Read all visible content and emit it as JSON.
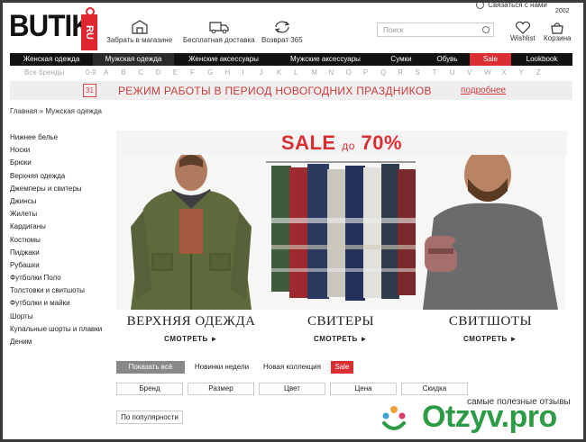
{
  "logo": {
    "word": "BUTIK",
    "badge": "RU"
  },
  "header": {
    "contact": "Связаться с нами",
    "year": "2002",
    "features": [
      "Забрать в магазине",
      "Бесплатная доставка",
      "Возврат 365"
    ],
    "search_placeholder": "Поиск",
    "wishlist": "Wishlist",
    "cart": "Корзина"
  },
  "nav": [
    "Женская одежда",
    "Мужская одежда",
    "Женские аксессуары",
    "Мужские аксессуары",
    "Сумки",
    "Обувь",
    "Sale",
    "Lookbook"
  ],
  "alphabet": [
    "Все бренды",
    "0-9",
    "A",
    "B",
    "C",
    "D",
    "E",
    "F",
    "G",
    "H",
    "I",
    "J",
    "K",
    "L",
    "M",
    "N",
    "O",
    "P",
    "Q",
    "R",
    "S",
    "T",
    "U",
    "V",
    "W",
    "X",
    "Y",
    "Z"
  ],
  "banner": {
    "day": "31",
    "text": "РЕЖИМ РАБОТЫ В ПЕРИОД НОВОГОДНИХ ПРАЗДНИКОВ",
    "link": "подробнее"
  },
  "breadcrumb": "Главная » Мужская одежда",
  "sidebar": [
    "Нижнее белье",
    "Носки",
    "Брюки",
    "Верхняя одежда",
    "Джемперы и свитеры",
    "Джинсы",
    "Жилеты",
    "Кардиганы",
    "Костюмы",
    "Пиджаки",
    "Рубашки",
    "Футболки Поло",
    "Толстовки и свитшоты",
    "Футболки и майки",
    "Шорты",
    "Купальные шорты и плавки",
    "Деним"
  ],
  "promo": {
    "sale": "SALE",
    "sale_small": "до",
    "sale_pct": "70%",
    "panels": [
      {
        "caption": "ВЕРХНЯЯ ОДЕЖДА",
        "more": "СМОТРЕТЬ ►"
      },
      {
        "caption": "СВИТЕРЫ",
        "more": "СМОТРЕТЬ ►"
      },
      {
        "caption": "СВИТШОТЫ",
        "more": "СМОТРЕТЬ ►"
      }
    ]
  },
  "tabs": [
    "Показать всё",
    "Новинки недели",
    "Новая коллекция",
    "Sale"
  ],
  "filters": [
    "Бренд",
    "Размер",
    "Цвет",
    "Цена",
    "Скидка"
  ],
  "sort": "По популярности",
  "watermark": {
    "caption": "самые полезные отзывы",
    "brand": "Otzyv.pro"
  },
  "colors": {
    "accent": "#d92f33",
    "nav_bg": "#111111",
    "banner_text": "#cc3a3a",
    "watermark_green": "#2d9b45"
  }
}
